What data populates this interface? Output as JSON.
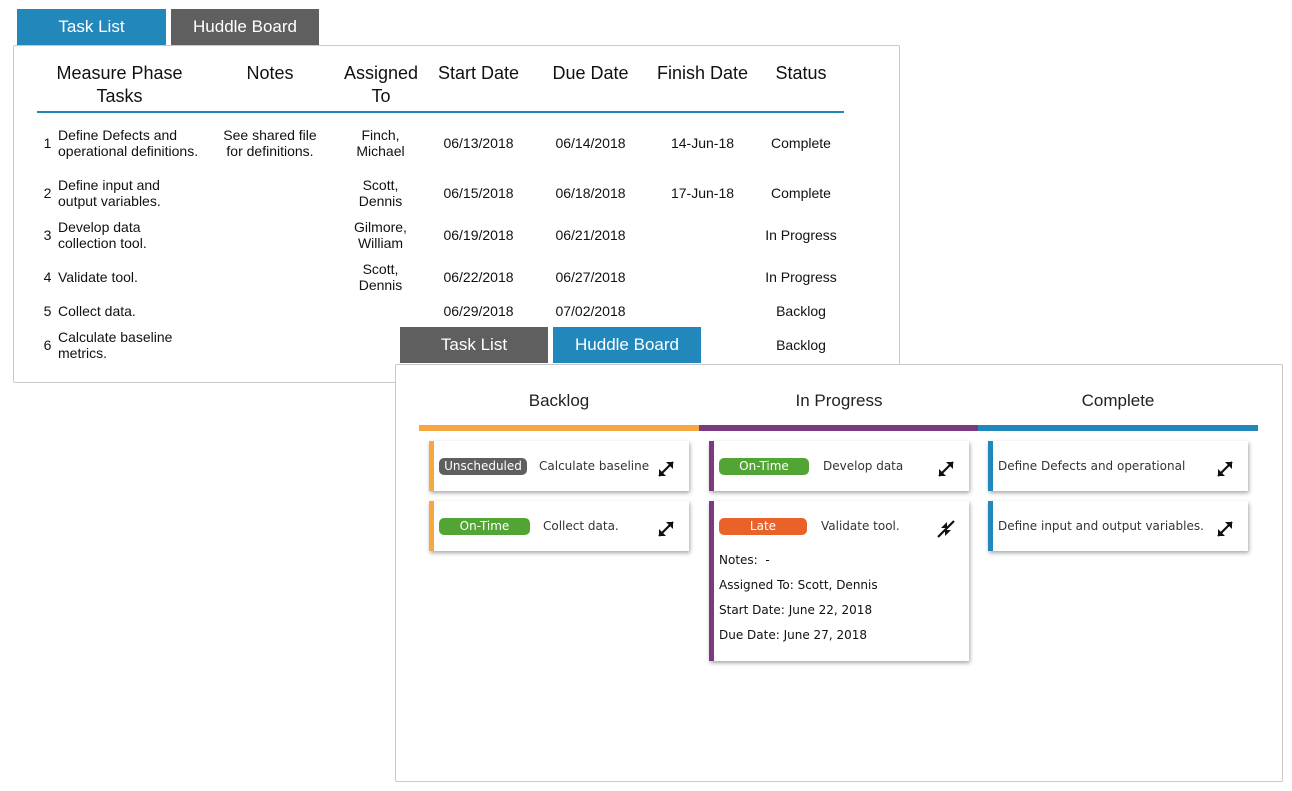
{
  "task_list_view": {
    "tabs": [
      {
        "label": "Task List",
        "active": true
      },
      {
        "label": "Huddle Board",
        "active": false
      }
    ],
    "columns": {
      "tasks": "Measure Phase Tasks",
      "notes": "Notes",
      "assigned": "Assigned To",
      "start": "Start Date",
      "due": "Due Date",
      "finish": "Finish Date",
      "status": "Status"
    },
    "rows": [
      {
        "num": "1",
        "task": "Define Defects and operational definitions.",
        "notes": "See shared file for definitions.",
        "assigned": "Finch, Michael",
        "start": "06/13/2018",
        "due": "06/14/2018",
        "finish": "14-Jun-18",
        "status": "Complete"
      },
      {
        "num": "2",
        "task": "Define input and output variables.",
        "notes": "",
        "assigned": "Scott, Dennis",
        "start": "06/15/2018",
        "due": "06/18/2018",
        "finish": "17-Jun-18",
        "status": "Complete"
      },
      {
        "num": "3",
        "task": "Develop data collection tool.",
        "notes": "",
        "assigned": "Gilmore, William",
        "start": "06/19/2018",
        "due": "06/21/2018",
        "finish": "",
        "status": "In Progress"
      },
      {
        "num": "4",
        "task": "Validate tool.",
        "notes": "",
        "assigned": "Scott, Dennis",
        "start": "06/22/2018",
        "due": "06/27/2018",
        "finish": "",
        "status": "In Progress"
      },
      {
        "num": "5",
        "task": "Collect data.",
        "notes": "",
        "assigned": "",
        "start": "06/29/2018",
        "due": "07/02/2018",
        "finish": "",
        "status": "Backlog"
      },
      {
        "num": "6",
        "task": "Calculate baseline metrics.",
        "notes": "",
        "assigned": "",
        "start": "",
        "due": "",
        "finish": "",
        "status": "Backlog"
      }
    ]
  },
  "huddle_board_view": {
    "tabs": [
      {
        "label": "Task List",
        "active": false
      },
      {
        "label": "Huddle Board",
        "active": true
      }
    ],
    "columns": [
      {
        "title": "Backlog",
        "color": "#f5a742"
      },
      {
        "title": "In Progress",
        "color": "#7b3a7f"
      },
      {
        "title": "Complete",
        "color": "#2288bb"
      }
    ],
    "badge_colors": {
      "Unscheduled": "#5f5f5f",
      "On-Time": "#52a535",
      "Late": "#e8622a"
    },
    "cards": {
      "backlog_1": {
        "badge": "Unscheduled",
        "title": "Calculate baseline",
        "icon": "expand-icon"
      },
      "backlog_2": {
        "badge": "On-Time",
        "title": "Collect data.",
        "icon": "expand-icon"
      },
      "progress_1": {
        "badge": "On-Time",
        "title": "Develop data",
        "icon": "expand-icon"
      },
      "progress_2": {
        "badge": "Late",
        "title": "Validate tool.",
        "icon": "collapse-icon",
        "notes_label": "Notes:",
        "notes_value": "-",
        "assigned_label": "Assigned To:",
        "assigned_value": "Scott, Dennis",
        "start_label": "Start Date:",
        "start_value": "June 22, 2018",
        "due_label": "Due Date:",
        "due_value": "June 27, 2018"
      },
      "complete_1": {
        "title": "Define Defects and operational",
        "icon": "expand-icon"
      },
      "complete_2": {
        "title": "Define input and output variables.",
        "icon": "expand-icon"
      }
    }
  }
}
